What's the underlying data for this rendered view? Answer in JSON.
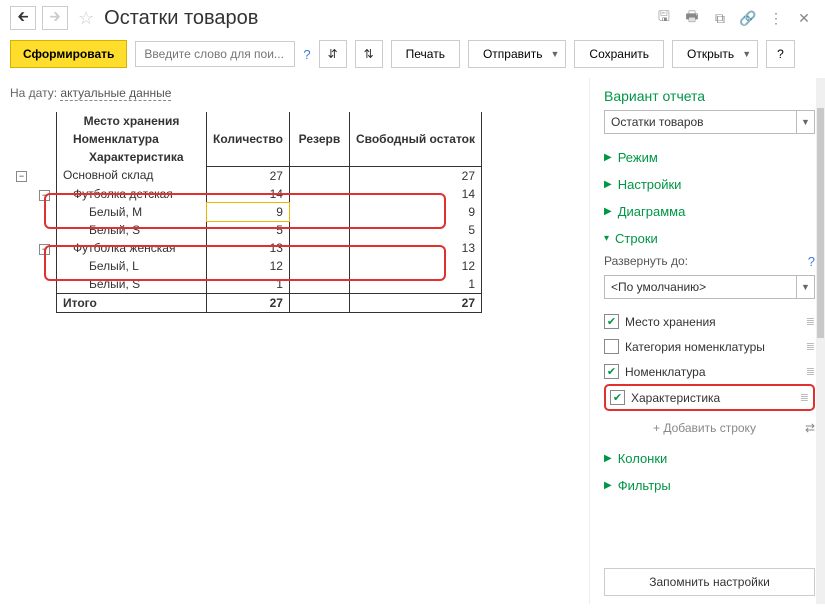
{
  "header": {
    "title": "Остатки товаров"
  },
  "toolbar": {
    "generate": "Сформировать",
    "search_placeholder": "Введите слово для пои...",
    "print": "Печать",
    "send": "Отправить",
    "save": "Сохранить",
    "open": "Открыть"
  },
  "date_line": {
    "label": "На дату:",
    "value": "актуальные данные"
  },
  "table": {
    "headers": {
      "storage": "Место хранения",
      "nomenclature": "Номенклатура",
      "characteristic": "Характеристика",
      "qty": "Количество",
      "reserve": "Резерв",
      "free": "Свободный остаток"
    },
    "rows": [
      {
        "level": 0,
        "name": "Основной склад",
        "qty": "27",
        "free": "27"
      },
      {
        "level": 1,
        "name": "Футболка детская",
        "qty": "14",
        "free": "14"
      },
      {
        "level": 2,
        "name": "Белый, M",
        "qty": "9",
        "free": "9",
        "yellow": true
      },
      {
        "level": 2,
        "name": "Белый, S",
        "qty": "5",
        "free": "5"
      },
      {
        "level": 1,
        "name": "Футболка женская",
        "qty": "13",
        "free": "13"
      },
      {
        "level": 2,
        "name": "Белый, L",
        "qty": "12",
        "free": "12"
      },
      {
        "level": 2,
        "name": "Белый, S",
        "qty": "1",
        "free": "1"
      }
    ],
    "total": {
      "label": "Итого",
      "qty": "27",
      "free": "27"
    }
  },
  "right": {
    "title": "Вариант отчета",
    "variant": "Остатки товаров",
    "sections": {
      "mode": "Режим",
      "settings": "Настройки",
      "chart": "Диаграмма",
      "rows": "Строки",
      "expand": "Развернуть до:",
      "default": "<По умолчанию>",
      "add_row": "+ Добавить строку",
      "columns": "Колонки",
      "filters": "Фильтры"
    },
    "checks": [
      {
        "label": "Место хранения",
        "checked": true
      },
      {
        "label": "Категория номенклатуры",
        "checked": false
      },
      {
        "label": "Номенклатура",
        "checked": true
      },
      {
        "label": "Характеристика",
        "checked": true,
        "highlight": true
      }
    ],
    "remember": "Запомнить настройки"
  }
}
